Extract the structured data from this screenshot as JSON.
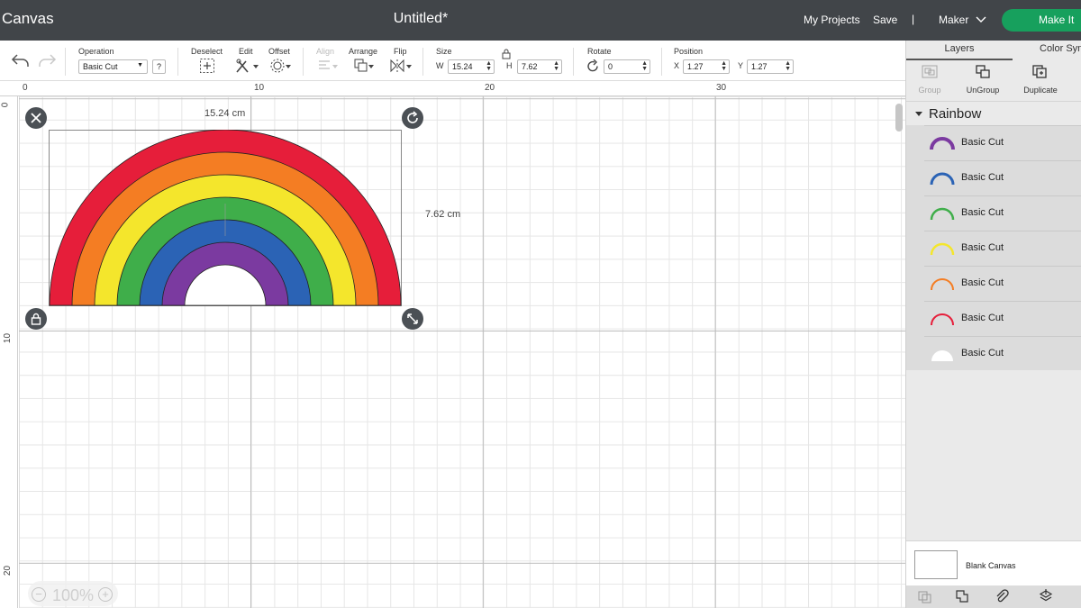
{
  "header": {
    "app_title": "Canvas",
    "doc_title": "Untitled*",
    "my_projects": "My Projects",
    "save": "Save",
    "divider": "|",
    "machine": "Maker",
    "make_it": "Make It"
  },
  "toolbar": {
    "undo_icon": "undo-icon",
    "redo_icon": "redo-icon",
    "operation_label": "Operation",
    "operation_value": "Basic Cut",
    "help": "?",
    "deselect_label": "Deselect",
    "edit_label": "Edit",
    "offset_label": "Offset",
    "align_label": "Align",
    "arrange_label": "Arrange",
    "flip_label": "Flip",
    "size_label": "Size",
    "w_label": "W",
    "w_value": "15.24",
    "h_label": "H",
    "h_value": "7.62",
    "rotate_label": "Rotate",
    "rotate_value": "0",
    "position_label": "Position",
    "x_label": "X",
    "x_value": "1.27",
    "y_label": "Y",
    "y_value": "1.27"
  },
  "rulers": {
    "top": [
      "0",
      "10",
      "20",
      "30"
    ],
    "left": [
      "0",
      "10",
      "20"
    ]
  },
  "canvas": {
    "width_label": "15.24 cm",
    "height_label": "7.62 cm",
    "zoom": "100%",
    "zoom_minus": "−",
    "zoom_plus": "+"
  },
  "panel": {
    "tab_layers": "Layers",
    "tab_color_sync": "Color Sync",
    "group_btn": "Group",
    "ungroup_btn": "UnGroup",
    "duplicate_btn": "Duplicate",
    "group_name": "Rainbow",
    "layers": [
      {
        "name": "Basic Cut",
        "color": "#7b3aa0"
      },
      {
        "name": "Basic Cut",
        "color": "#2b63b5"
      },
      {
        "name": "Basic Cut",
        "color": "#3fae4a"
      },
      {
        "name": "Basic Cut",
        "color": "#f4e62c"
      },
      {
        "name": "Basic Cut",
        "color": "#f47d23"
      },
      {
        "name": "Basic Cut",
        "color": "#e61e3a"
      },
      {
        "name": "Basic Cut",
        "color": "#ffffff"
      }
    ],
    "blank_canvas": "Blank Canvas"
  },
  "colors": {
    "header_bg": "#414549",
    "make_it_green": "#17a05d",
    "red": "#e61e3a",
    "orange": "#f47d23",
    "yellow": "#f4e62c",
    "green": "#3fae4a",
    "blue": "#2b63b5",
    "purple": "#7b3aa0"
  }
}
